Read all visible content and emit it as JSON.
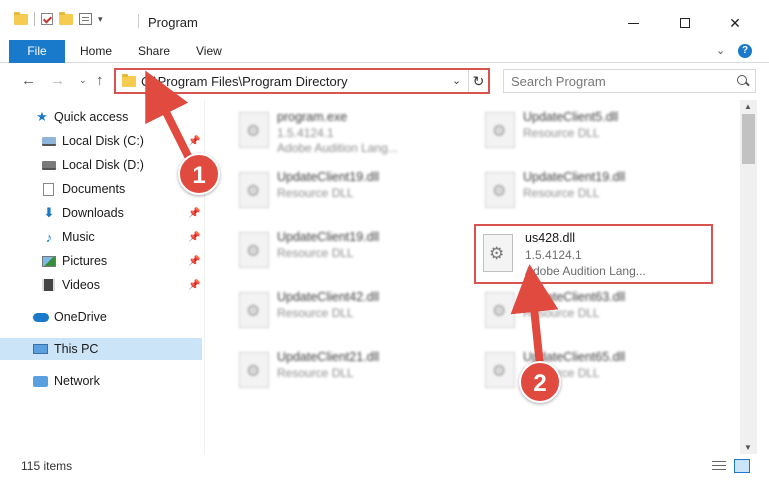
{
  "window": {
    "title": "Program",
    "quick_access_caret": "▾",
    "minimize": "—",
    "maximize": "☐",
    "close": "✕"
  },
  "ribbon": {
    "tabs": [
      "File",
      "Home",
      "Share",
      "View"
    ],
    "expand": "⌄",
    "help": "?"
  },
  "nav": {
    "back": "←",
    "forward": "→",
    "history": "⌄",
    "up": "↑",
    "address": "C:\\Program Files\\Program Directory",
    "address_dropdown": "⌄",
    "refresh": "↻",
    "search_placeholder": "Search Program"
  },
  "sidebar": {
    "items": [
      {
        "label": "Quick access",
        "icon": "star-icon",
        "pinned": false
      },
      {
        "label": "Local Disk (C:)",
        "icon": "disk-c-icon",
        "pinned": true
      },
      {
        "label": "Local Disk (D:)",
        "icon": "disk-d-icon",
        "pinned": false
      },
      {
        "label": "Documents",
        "icon": "documents-icon",
        "pinned": true
      },
      {
        "label": "Downloads",
        "icon": "downloads-icon",
        "pinned": true
      },
      {
        "label": "Music",
        "icon": "music-icon",
        "pinned": true
      },
      {
        "label": "Pictures",
        "icon": "pictures-icon",
        "pinned": true
      },
      {
        "label": "Videos",
        "icon": "videos-icon",
        "pinned": true
      },
      {
        "label": "OneDrive",
        "icon": "onedrive-icon",
        "pinned": false
      },
      {
        "label": "This PC",
        "icon": "this-pc-icon",
        "pinned": false,
        "selected": true
      },
      {
        "label": "Network",
        "icon": "network-icon",
        "pinned": false
      }
    ],
    "pin_glyph": "📌"
  },
  "files": [
    {
      "name": "program.exe",
      "version": "1.5.4124.1",
      "desc": "Adobe Audition Lang..."
    },
    {
      "name": "UpdateClient5.dll",
      "version": "Resource DLL",
      "desc": ""
    },
    {
      "name": "UpdateClient19.dll",
      "version": "Resource DLL",
      "desc": ""
    },
    {
      "name": "UpdateClient19.dll",
      "version": "Resource DLL",
      "desc": ""
    },
    {
      "name": "UpdateClient19.dll",
      "version": "Resource DLL",
      "desc": ""
    },
    {
      "name": "UpdateClient42.dll",
      "version": "Resource DLL",
      "desc": ""
    },
    {
      "name": "UpdateClient63.dll",
      "version": "Resource DLL",
      "desc": ""
    },
    {
      "name": "UpdateClient21.dll",
      "version": "Resource DLL",
      "desc": ""
    },
    {
      "name": "UpdateClient65.dll",
      "version": "Resource DLL",
      "desc": ""
    }
  ],
  "highlighted_file": {
    "name": "us428.dll",
    "version": "1.5.4124.1",
    "desc": "Adobe Audition Lang..."
  },
  "status": {
    "items_count": "115 items"
  },
  "annotations": {
    "step1": "1",
    "step2": "2",
    "arrow_color": "#e04a3f"
  },
  "colors": {
    "accent": "#1979ca",
    "highlight_border": "#d9534f",
    "selected_bg": "#cce4f7"
  }
}
